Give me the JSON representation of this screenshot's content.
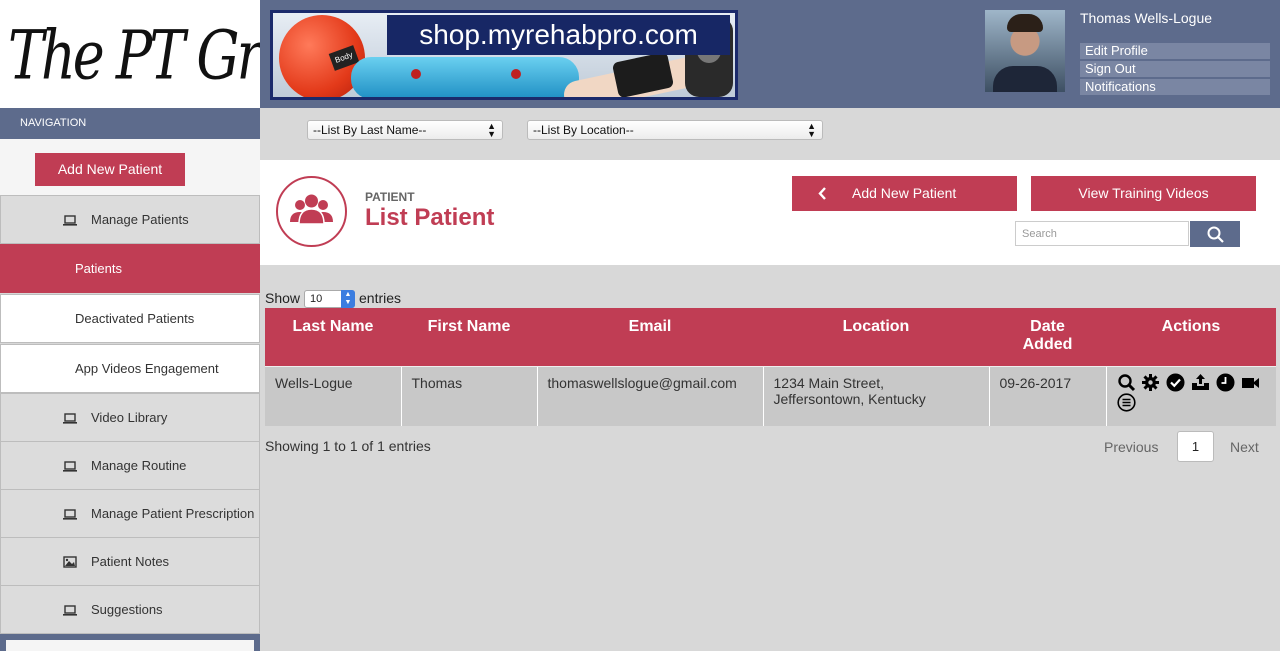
{
  "logo": {
    "text": "The PT Group"
  },
  "banner": {
    "url": "shop.myrehabpro.com",
    "ball_label": "Body"
  },
  "user": {
    "name": "Thomas Wells-Logue",
    "links": [
      "Edit Profile",
      "Sign Out",
      "Notifications"
    ]
  },
  "nav": {
    "heading": "NAVIGATION",
    "add_button": "Add New Patient",
    "items": [
      {
        "label": "Manage Patients",
        "icon": "laptop-icon"
      },
      {
        "label": "Patients",
        "sub": true,
        "active": true
      },
      {
        "label": "Deactivated Patients",
        "sub": true
      },
      {
        "label": "App Videos Engagement",
        "sub": true
      },
      {
        "label": "Video Library",
        "icon": "laptop-icon"
      },
      {
        "label": "Manage Routine",
        "icon": "laptop-icon"
      },
      {
        "label": "Manage Patient Prescription",
        "icon": "laptop-icon"
      },
      {
        "label": "Patient Notes",
        "icon": "image-icon"
      },
      {
        "label": "Suggestions",
        "icon": "laptop-icon"
      }
    ]
  },
  "filters": {
    "last_name": "--List By Last Name--",
    "location": "--List By Location--"
  },
  "page": {
    "subtitle": "PATIENT",
    "title": "List Patient",
    "add_button": "Add New Patient",
    "training_button": "View Training Videos",
    "search_placeholder": "Search"
  },
  "table": {
    "show_label": "Show",
    "show_value": "10",
    "entries_label": "entries",
    "columns": [
      "Last Name",
      "First Name",
      "Email",
      "Location",
      "Date Added",
      "Actions"
    ],
    "rows": [
      {
        "last_name": "Wells-Logue",
        "first_name": "Thomas",
        "email": "thomaswellslogue@gmail.com",
        "location": "1234 Main Street, Jeffersontown, Kentucky",
        "date_added": "09-26-2017",
        "actions": [
          "search-icon",
          "gear-icon",
          "check-circle-icon",
          "inbox-upload-icon",
          "clock-icon",
          "video-camera-icon",
          "list-circle-icon"
        ]
      }
    ],
    "summary": "Showing 1 to 1 of 1 entries"
  },
  "pagination": {
    "previous": "Previous",
    "page": "1",
    "next": "Next"
  },
  "colors": {
    "accent": "#c03d54",
    "header": "#5d6b8c"
  }
}
